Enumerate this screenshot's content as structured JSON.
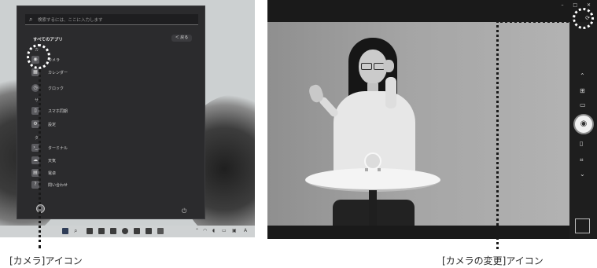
{
  "start_menu": {
    "search_placeholder": "検索するには、ここに入力します",
    "all_apps_heading": "すべてのアプリ",
    "back_label": "＜ 戻る",
    "apps": [
      {
        "label": "カメラ",
        "icon": "camera-icon"
      },
      {
        "label": "カレンダー",
        "icon": "calendar-icon"
      },
      {
        "label": "クロック",
        "icon": "clock-icon"
      },
      {
        "label": "スマホ同期",
        "icon": "phone-link-icon"
      },
      {
        "label": "設定",
        "icon": "settings-icon"
      },
      {
        "label": "ターミナル",
        "icon": "terminal-icon"
      },
      {
        "label": "天気",
        "icon": "weather-icon"
      },
      {
        "label": "電卓",
        "icon": "calculator-icon"
      },
      {
        "label": "問い合わせ",
        "icon": "help-icon"
      }
    ],
    "section_letters": [
      "カ",
      "サ",
      "タ"
    ]
  },
  "camera_app": {
    "window_controls": [
      "–",
      "□",
      "✕"
    ]
  },
  "captions": {
    "camera_icon": "[カメラ]アイコン",
    "change_camera_icon": "[カメラの変更]アイコン"
  },
  "colors": {
    "highlight": "#ffffff",
    "leader_line": "#1a1a1a"
  }
}
